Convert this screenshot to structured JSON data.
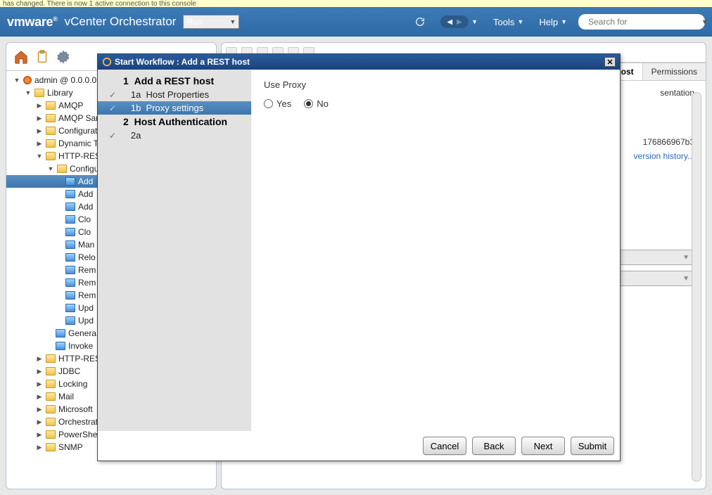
{
  "notice": "has changed. There is now 1 active connection to this console",
  "header": {
    "brand1": "vm",
    "brand2": "ware",
    "product": "vCenter Orchestrator",
    "run_label": "Run",
    "tools_label": "Tools",
    "help_label": "Help",
    "search_placeholder": "Search for"
  },
  "tree_root": "admin @ 0.0.0.0",
  "tree": {
    "library": "Library",
    "amqp": "AMQP",
    "amqp_san": "AMQP San",
    "configurat": "Configurat",
    "dynamic_t": "Dynamic T",
    "http_rest": "HTTP-REST",
    "configu": "Configu",
    "add_sel": "Add",
    "add2": "Add",
    "add3": "Add",
    "clo1": "Clo",
    "clo2": "Clo",
    "man": "Man",
    "relo": "Relo",
    "rem1": "Rem",
    "rem2": "Rem",
    "rem3": "Rem",
    "upd1": "Upd",
    "upd2": "Upd",
    "genera": "Genera",
    "invoke": "Invoke",
    "http_rest2": "HTTP-REST",
    "jdbc": "JDBC",
    "locking": "Locking",
    "mail": "Mail",
    "microsoft": "Microsoft",
    "orchestrat": "Orchestrat",
    "powershe": "PowerShe",
    "snmp": "SNMP"
  },
  "right": {
    "tab_active": "Add a REST host",
    "tab_permissions": "Permissions",
    "tab_sentation": "sentation",
    "id_val": "176866967b3",
    "version_link": "version history..."
  },
  "dialog": {
    "title": "Start Workflow : Add a REST host",
    "step1": "1",
    "step1_label": "Add a REST host",
    "step1a": "1a",
    "step1a_label": "Host Properties",
    "step1b": "1b",
    "step1b_label": "Proxy settings",
    "step2": "2",
    "step2_label": "Host Authentication",
    "step2a": "2a",
    "useproxy_label": "Use Proxy",
    "yes": "Yes",
    "no": "No",
    "btn_cancel": "Cancel",
    "btn_back": "Back",
    "btn_next": "Next",
    "btn_submit": "Submit"
  }
}
